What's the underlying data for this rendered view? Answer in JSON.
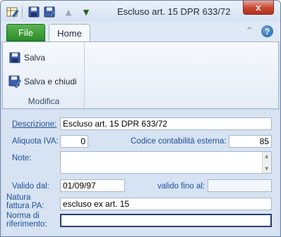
{
  "window": {
    "title": "Escluso art. 15 DPR 633/72",
    "close_symbol": "x"
  },
  "quick_access": {
    "app_icon": "table-edit-icon",
    "save_icon": "floppy-save-icon",
    "save_close_icon": "floppy-save-close-icon",
    "up_icon": "triangle-up-icon",
    "down_icon": "triangle-down-icon"
  },
  "ribbon": {
    "tabs": {
      "file": "File",
      "home": "Home"
    },
    "help_symbol": "?",
    "minimize_symbol": "^",
    "groups": [
      {
        "label": "Modifica",
        "buttons": [
          {
            "label": "Salva",
            "icon": "floppy-save-icon"
          },
          {
            "label": "Salva e chiudi",
            "icon": "floppy-save-close-icon"
          }
        ]
      }
    ]
  },
  "form": {
    "descrizione": {
      "label": "Descrizione:",
      "value": "Escluso art. 15 DPR 633/72"
    },
    "aliquota_iva": {
      "label": "Aliquota IVA:",
      "value": "0"
    },
    "codice_contabilita": {
      "label": "Codice contabilità esterna:",
      "value": "85"
    },
    "note": {
      "label": "Note:",
      "value": ""
    },
    "valido_dal": {
      "label": "Valido dal:",
      "value": "01/09/97"
    },
    "valido_fino_al": {
      "label": "valido fino al:",
      "value": ""
    },
    "natura_fattura_pa": {
      "label_line1": "Natura",
      "label_line2": "fattura PA:",
      "value": "escluso ex art. 15"
    },
    "norma_riferimento": {
      "label_line1": "Norma di",
      "label_line2": "riferimento:",
      "value": ""
    }
  },
  "colors": {
    "file_tab": "#2a8a27",
    "close_button": "#c7432f",
    "label_text": "#1e50a0",
    "form_background": "#d7e3f2"
  }
}
